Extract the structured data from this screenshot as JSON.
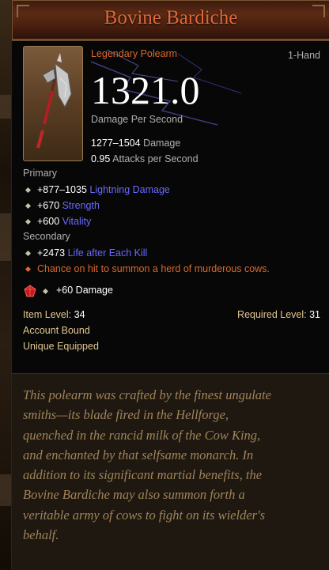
{
  "item": {
    "name": "Bovine Bardiche",
    "type": "Legendary Polearm",
    "hand": "1-Hand",
    "dps": "1321.0",
    "dps_label": "Damage Per Second",
    "damage_range": "1277–1504",
    "damage_label": "Damage",
    "aps": "0.95",
    "aps_label": "Attacks per Second",
    "icon": "polearm-axe-icon"
  },
  "primary": {
    "heading": "Primary",
    "affixes": [
      {
        "value": "+877–1035",
        "stat": "Lightning Damage"
      },
      {
        "value": "+670",
        "stat": "Strength"
      },
      {
        "value": "+600",
        "stat": "Vitality"
      }
    ]
  },
  "secondary": {
    "heading": "Secondary",
    "affixes": [
      {
        "value": "+2473",
        "stat": "Life after Each Kill"
      }
    ],
    "legendary_power": "Chance on hit to summon a herd of murderous cows."
  },
  "socket": {
    "icon": "ruby-gem-icon",
    "text": "+60 Damage"
  },
  "requirements": {
    "item_level_label": "Item Level:",
    "item_level": "34",
    "required_level_label": "Required Level:",
    "required_level": "31",
    "account_bound": "Account Bound",
    "unique_equipped": "Unique Equipped"
  },
  "flavor_lines": [
    "This polearm was crafted by the finest ungulate",
    "smiths—its blade fired in the Hellforge,",
    "quenched in the rancid milk of the Cow King,",
    "and enchanted by that selfsame monarch. In",
    "addition to its significant martial benefits, the",
    "Bovine Bardiche may also summon forth a",
    "veritable army of cows to fight on its wielder's",
    "behalf."
  ],
  "colors": {
    "legendary": "#d9692e",
    "magic": "#6969ff",
    "flavor": "#a0845a",
    "requirement": "#e0c890"
  }
}
